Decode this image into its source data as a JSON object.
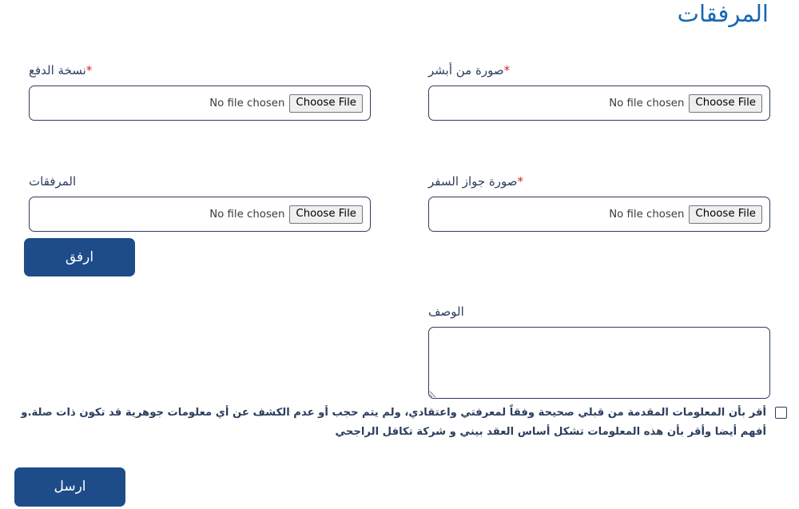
{
  "page": {
    "title": "المرفقات",
    "title_color": "#1668b0",
    "primary_color": "#1d4c89",
    "border_color": "#2c3e5d",
    "required_color": "#e0202a"
  },
  "fields": [
    {
      "key": "absher_image",
      "label": "صورة من أبشر",
      "required": true,
      "required_mark": "*",
      "file_status": "No file chosen",
      "button_label": "Choose File"
    },
    {
      "key": "payment_copy",
      "label": "نسخة الدفع",
      "required": true,
      "required_mark": "*",
      "file_status": "No file chosen",
      "button_label": "Choose File"
    },
    {
      "key": "passport_image",
      "label": "صورة جواز السفر",
      "required": true,
      "required_mark": "*",
      "file_status": "No file chosen",
      "button_label": "Choose File"
    },
    {
      "key": "attachments",
      "label": "المرفقات",
      "required": false,
      "required_mark": "",
      "file_status": "No file chosen",
      "button_label": "Choose File"
    }
  ],
  "attach_button": {
    "label": "ارفق"
  },
  "description": {
    "label": "الوصف",
    "value": "",
    "placeholder": ""
  },
  "consent": {
    "checked": false,
    "text": "أقر بأن المعلومات المقدمة من قبلي صحيحة وفقاً لمعرفتي واعتقادي، ولم يتم حجب أو عدم الكشف عن أي معلومات جوهرية قد تكون ذات صلة.و أفهم أيضا وأقر بأن هذه المعلومات تشكل أساس العقد بيني و شركة تكافل الراجحي"
  },
  "submit_button": {
    "label": "ارسل"
  }
}
